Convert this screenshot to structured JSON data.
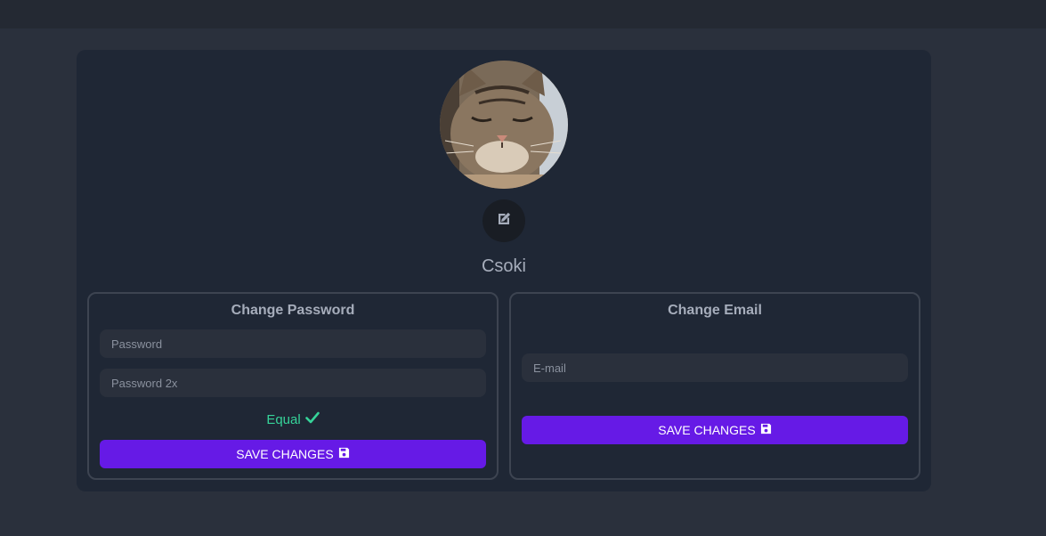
{
  "profile": {
    "username": "Csoki"
  },
  "password_panel": {
    "title": "Change Password",
    "password_placeholder": "Password",
    "password_repeat_placeholder": "Password 2x",
    "match_status": "Equal",
    "save_label": "SAVE CHANGES"
  },
  "email_panel": {
    "title": "Change Email",
    "email_placeholder": "E-mail",
    "save_label": "SAVE CHANGES"
  },
  "icons": {
    "edit": "pen-to-square-icon",
    "match": "check-icon",
    "save": "floppy-disk-icon"
  },
  "colors": {
    "accent": "#661ae6",
    "success": "#36d399",
    "card": "#1f2735",
    "background": "#2a303c"
  }
}
